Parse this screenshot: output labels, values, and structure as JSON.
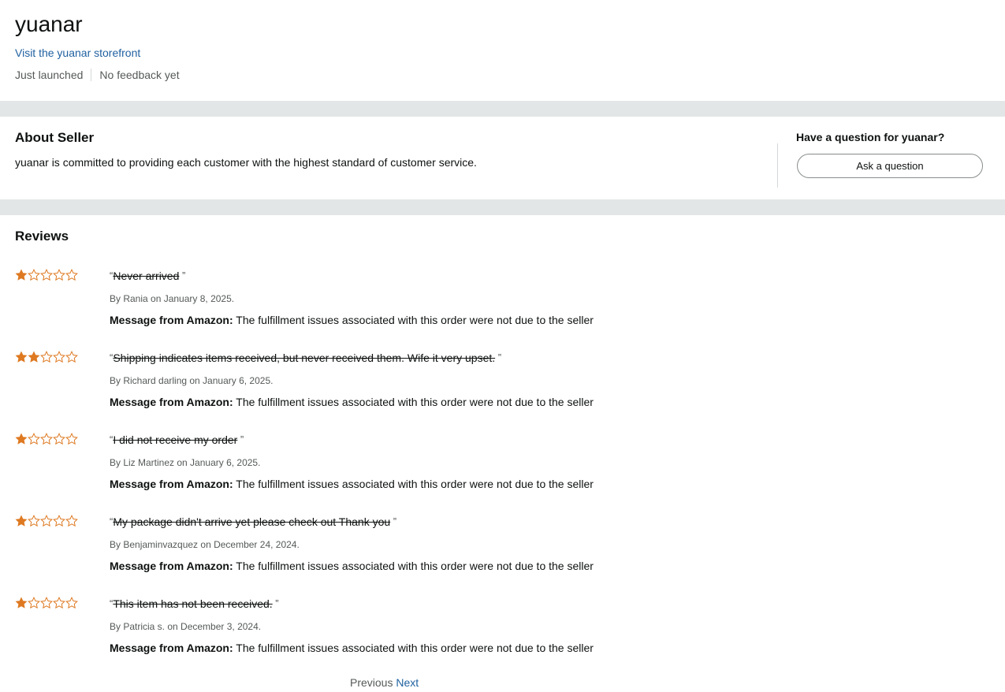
{
  "seller": {
    "name": "yuanar",
    "storefront_link": "Visit the yuanar storefront",
    "status": "Just launched",
    "feedback": "No feedback yet"
  },
  "about": {
    "title": "About Seller",
    "text": "yuanar is committed to providing each customer with the highest standard of customer service.",
    "question_title": "Have a question for yuanar?",
    "ask_button": "Ask a question"
  },
  "reviews": {
    "title": "Reviews",
    "message_label": "Message from Amazon:",
    "message_text": "The fulfillment issues associated with this order were not due to the seller",
    "items": [
      {
        "rating": 1,
        "text": "Never arrived",
        "by": "By Rania on January 8, 2025."
      },
      {
        "rating": 2,
        "text": "Shipping indicates items received, but never received them. Wife it very upset.",
        "by": "By Richard darling on January 6, 2025."
      },
      {
        "rating": 1,
        "text": "I did not receive my order",
        "by": "By Liz Martinez on January 6, 2025."
      },
      {
        "rating": 1,
        "text": "My package didn't arrive yet please check out Thank you",
        "by": "By Benjaminvazquez on December 24, 2024."
      },
      {
        "rating": 1,
        "text": "This item has not been received.",
        "by": "By Patricia s. on December 3, 2024."
      }
    ],
    "max_rating": 5
  },
  "pagination": {
    "previous": "Previous",
    "next": "Next"
  },
  "colors": {
    "star": "#de7921",
    "link": "#2162a1",
    "band": "#e3e6e6"
  },
  "icons": {
    "star_filled": "star-filled-icon",
    "star_empty": "star-empty-icon"
  }
}
